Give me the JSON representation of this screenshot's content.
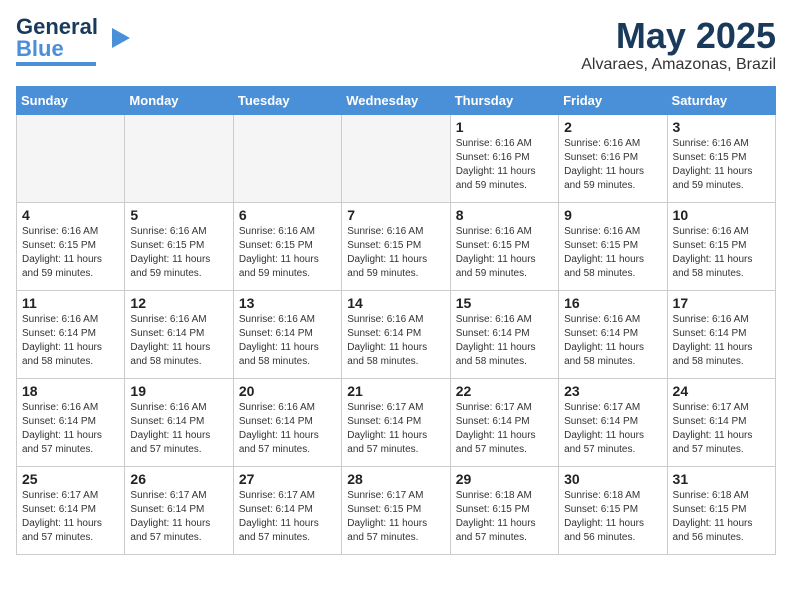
{
  "logo": {
    "line1": "General",
    "line2": "Blue"
  },
  "title": "May 2025",
  "location": "Alvaraes, Amazonas, Brazil",
  "days_of_week": [
    "Sunday",
    "Monday",
    "Tuesday",
    "Wednesday",
    "Thursday",
    "Friday",
    "Saturday"
  ],
  "weeks": [
    [
      {
        "day": "",
        "info": ""
      },
      {
        "day": "",
        "info": ""
      },
      {
        "day": "",
        "info": ""
      },
      {
        "day": "",
        "info": ""
      },
      {
        "day": "1",
        "info": "Sunrise: 6:16 AM\nSunset: 6:16 PM\nDaylight: 11 hours\nand 59 minutes."
      },
      {
        "day": "2",
        "info": "Sunrise: 6:16 AM\nSunset: 6:16 PM\nDaylight: 11 hours\nand 59 minutes."
      },
      {
        "day": "3",
        "info": "Sunrise: 6:16 AM\nSunset: 6:15 PM\nDaylight: 11 hours\nand 59 minutes."
      }
    ],
    [
      {
        "day": "4",
        "info": "Sunrise: 6:16 AM\nSunset: 6:15 PM\nDaylight: 11 hours\nand 59 minutes."
      },
      {
        "day": "5",
        "info": "Sunrise: 6:16 AM\nSunset: 6:15 PM\nDaylight: 11 hours\nand 59 minutes."
      },
      {
        "day": "6",
        "info": "Sunrise: 6:16 AM\nSunset: 6:15 PM\nDaylight: 11 hours\nand 59 minutes."
      },
      {
        "day": "7",
        "info": "Sunrise: 6:16 AM\nSunset: 6:15 PM\nDaylight: 11 hours\nand 59 minutes."
      },
      {
        "day": "8",
        "info": "Sunrise: 6:16 AM\nSunset: 6:15 PM\nDaylight: 11 hours\nand 59 minutes."
      },
      {
        "day": "9",
        "info": "Sunrise: 6:16 AM\nSunset: 6:15 PM\nDaylight: 11 hours\nand 58 minutes."
      },
      {
        "day": "10",
        "info": "Sunrise: 6:16 AM\nSunset: 6:15 PM\nDaylight: 11 hours\nand 58 minutes."
      }
    ],
    [
      {
        "day": "11",
        "info": "Sunrise: 6:16 AM\nSunset: 6:14 PM\nDaylight: 11 hours\nand 58 minutes."
      },
      {
        "day": "12",
        "info": "Sunrise: 6:16 AM\nSunset: 6:14 PM\nDaylight: 11 hours\nand 58 minutes."
      },
      {
        "day": "13",
        "info": "Sunrise: 6:16 AM\nSunset: 6:14 PM\nDaylight: 11 hours\nand 58 minutes."
      },
      {
        "day": "14",
        "info": "Sunrise: 6:16 AM\nSunset: 6:14 PM\nDaylight: 11 hours\nand 58 minutes."
      },
      {
        "day": "15",
        "info": "Sunrise: 6:16 AM\nSunset: 6:14 PM\nDaylight: 11 hours\nand 58 minutes."
      },
      {
        "day": "16",
        "info": "Sunrise: 6:16 AM\nSunset: 6:14 PM\nDaylight: 11 hours\nand 58 minutes."
      },
      {
        "day": "17",
        "info": "Sunrise: 6:16 AM\nSunset: 6:14 PM\nDaylight: 11 hours\nand 58 minutes."
      }
    ],
    [
      {
        "day": "18",
        "info": "Sunrise: 6:16 AM\nSunset: 6:14 PM\nDaylight: 11 hours\nand 57 minutes."
      },
      {
        "day": "19",
        "info": "Sunrise: 6:16 AM\nSunset: 6:14 PM\nDaylight: 11 hours\nand 57 minutes."
      },
      {
        "day": "20",
        "info": "Sunrise: 6:16 AM\nSunset: 6:14 PM\nDaylight: 11 hours\nand 57 minutes."
      },
      {
        "day": "21",
        "info": "Sunrise: 6:17 AM\nSunset: 6:14 PM\nDaylight: 11 hours\nand 57 minutes."
      },
      {
        "day": "22",
        "info": "Sunrise: 6:17 AM\nSunset: 6:14 PM\nDaylight: 11 hours\nand 57 minutes."
      },
      {
        "day": "23",
        "info": "Sunrise: 6:17 AM\nSunset: 6:14 PM\nDaylight: 11 hours\nand 57 minutes."
      },
      {
        "day": "24",
        "info": "Sunrise: 6:17 AM\nSunset: 6:14 PM\nDaylight: 11 hours\nand 57 minutes."
      }
    ],
    [
      {
        "day": "25",
        "info": "Sunrise: 6:17 AM\nSunset: 6:14 PM\nDaylight: 11 hours\nand 57 minutes."
      },
      {
        "day": "26",
        "info": "Sunrise: 6:17 AM\nSunset: 6:14 PM\nDaylight: 11 hours\nand 57 minutes."
      },
      {
        "day": "27",
        "info": "Sunrise: 6:17 AM\nSunset: 6:14 PM\nDaylight: 11 hours\nand 57 minutes."
      },
      {
        "day": "28",
        "info": "Sunrise: 6:17 AM\nSunset: 6:15 PM\nDaylight: 11 hours\nand 57 minutes."
      },
      {
        "day": "29",
        "info": "Sunrise: 6:18 AM\nSunset: 6:15 PM\nDaylight: 11 hours\nand 57 minutes."
      },
      {
        "day": "30",
        "info": "Sunrise: 6:18 AM\nSunset: 6:15 PM\nDaylight: 11 hours\nand 56 minutes."
      },
      {
        "day": "31",
        "info": "Sunrise: 6:18 AM\nSunset: 6:15 PM\nDaylight: 11 hours\nand 56 minutes."
      }
    ]
  ]
}
